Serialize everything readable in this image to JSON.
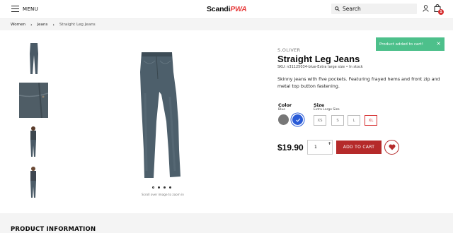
{
  "header": {
    "menu_label": "MENU",
    "logo_main": "Scandi",
    "logo_accent": "PWA",
    "search_label": "Search",
    "cart_count": "1",
    "brand_accent_color": "#e73f3f"
  },
  "breadcrumb": {
    "items": [
      "Women",
      "Jeans",
      "Straight Leg Jeans"
    ]
  },
  "toast": {
    "message": "Product added to cart!",
    "close": "×",
    "color": "#4dc08b"
  },
  "gallery": {
    "thumbnails": [
      "jeans-front-thumb",
      "denim-fabric-thumb",
      "model-back-thumb",
      "model-front-thumb"
    ],
    "dots": 4,
    "active_dot": 1,
    "zoom_hint": "Scroll over image to zoom in"
  },
  "product": {
    "brand": "S.OLIVER",
    "title": "Straight Leg Jeans",
    "sku": "SKU: n31125034-blue-Extra large size  •  In stock",
    "description": "Skinny jeans with five pockets. Featuring frayed hems and front zip and metal top button fastening.",
    "color_label": "Color",
    "color_value": "Blue",
    "size_label": "Size",
    "size_value": "Extra Large Size",
    "sizes": [
      "XS",
      "S",
      "L",
      "XL"
    ],
    "price": "$19.90",
    "qty": "1",
    "qty_plus": "+",
    "add_to_cart": "ADD TO CART",
    "accent_color": "#b52a2a"
  },
  "sections": {
    "product_info": "PRODUCT INFORMATION"
  }
}
